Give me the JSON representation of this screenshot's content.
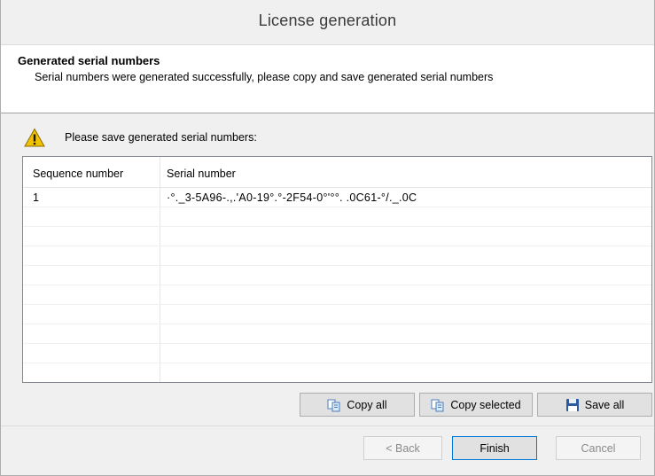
{
  "window": {
    "title": "License generation"
  },
  "header": {
    "title": "Generated serial numbers",
    "subtitle": "Serial numbers were generated successfully, please copy and save generated serial numbers"
  },
  "notice": {
    "text": "Please save generated serial numbers:",
    "icon": "warning-icon"
  },
  "table": {
    "columns": [
      "Sequence number",
      "Serial number"
    ],
    "rows": [
      {
        "seq": "1",
        "serial": "·°._3-5A96-.,.'A0-19°.°-2F54-0°'°°. .0C61-°/._.0C"
      }
    ]
  },
  "actions": {
    "copy_all": "Copy all",
    "copy_selected": "Copy selected",
    "save_all": "Save all"
  },
  "nav": {
    "back": "< Back",
    "finish": "Finish",
    "cancel": "Cancel"
  },
  "colors": {
    "focus_border": "#0078d7",
    "warning": "#f2c200"
  }
}
